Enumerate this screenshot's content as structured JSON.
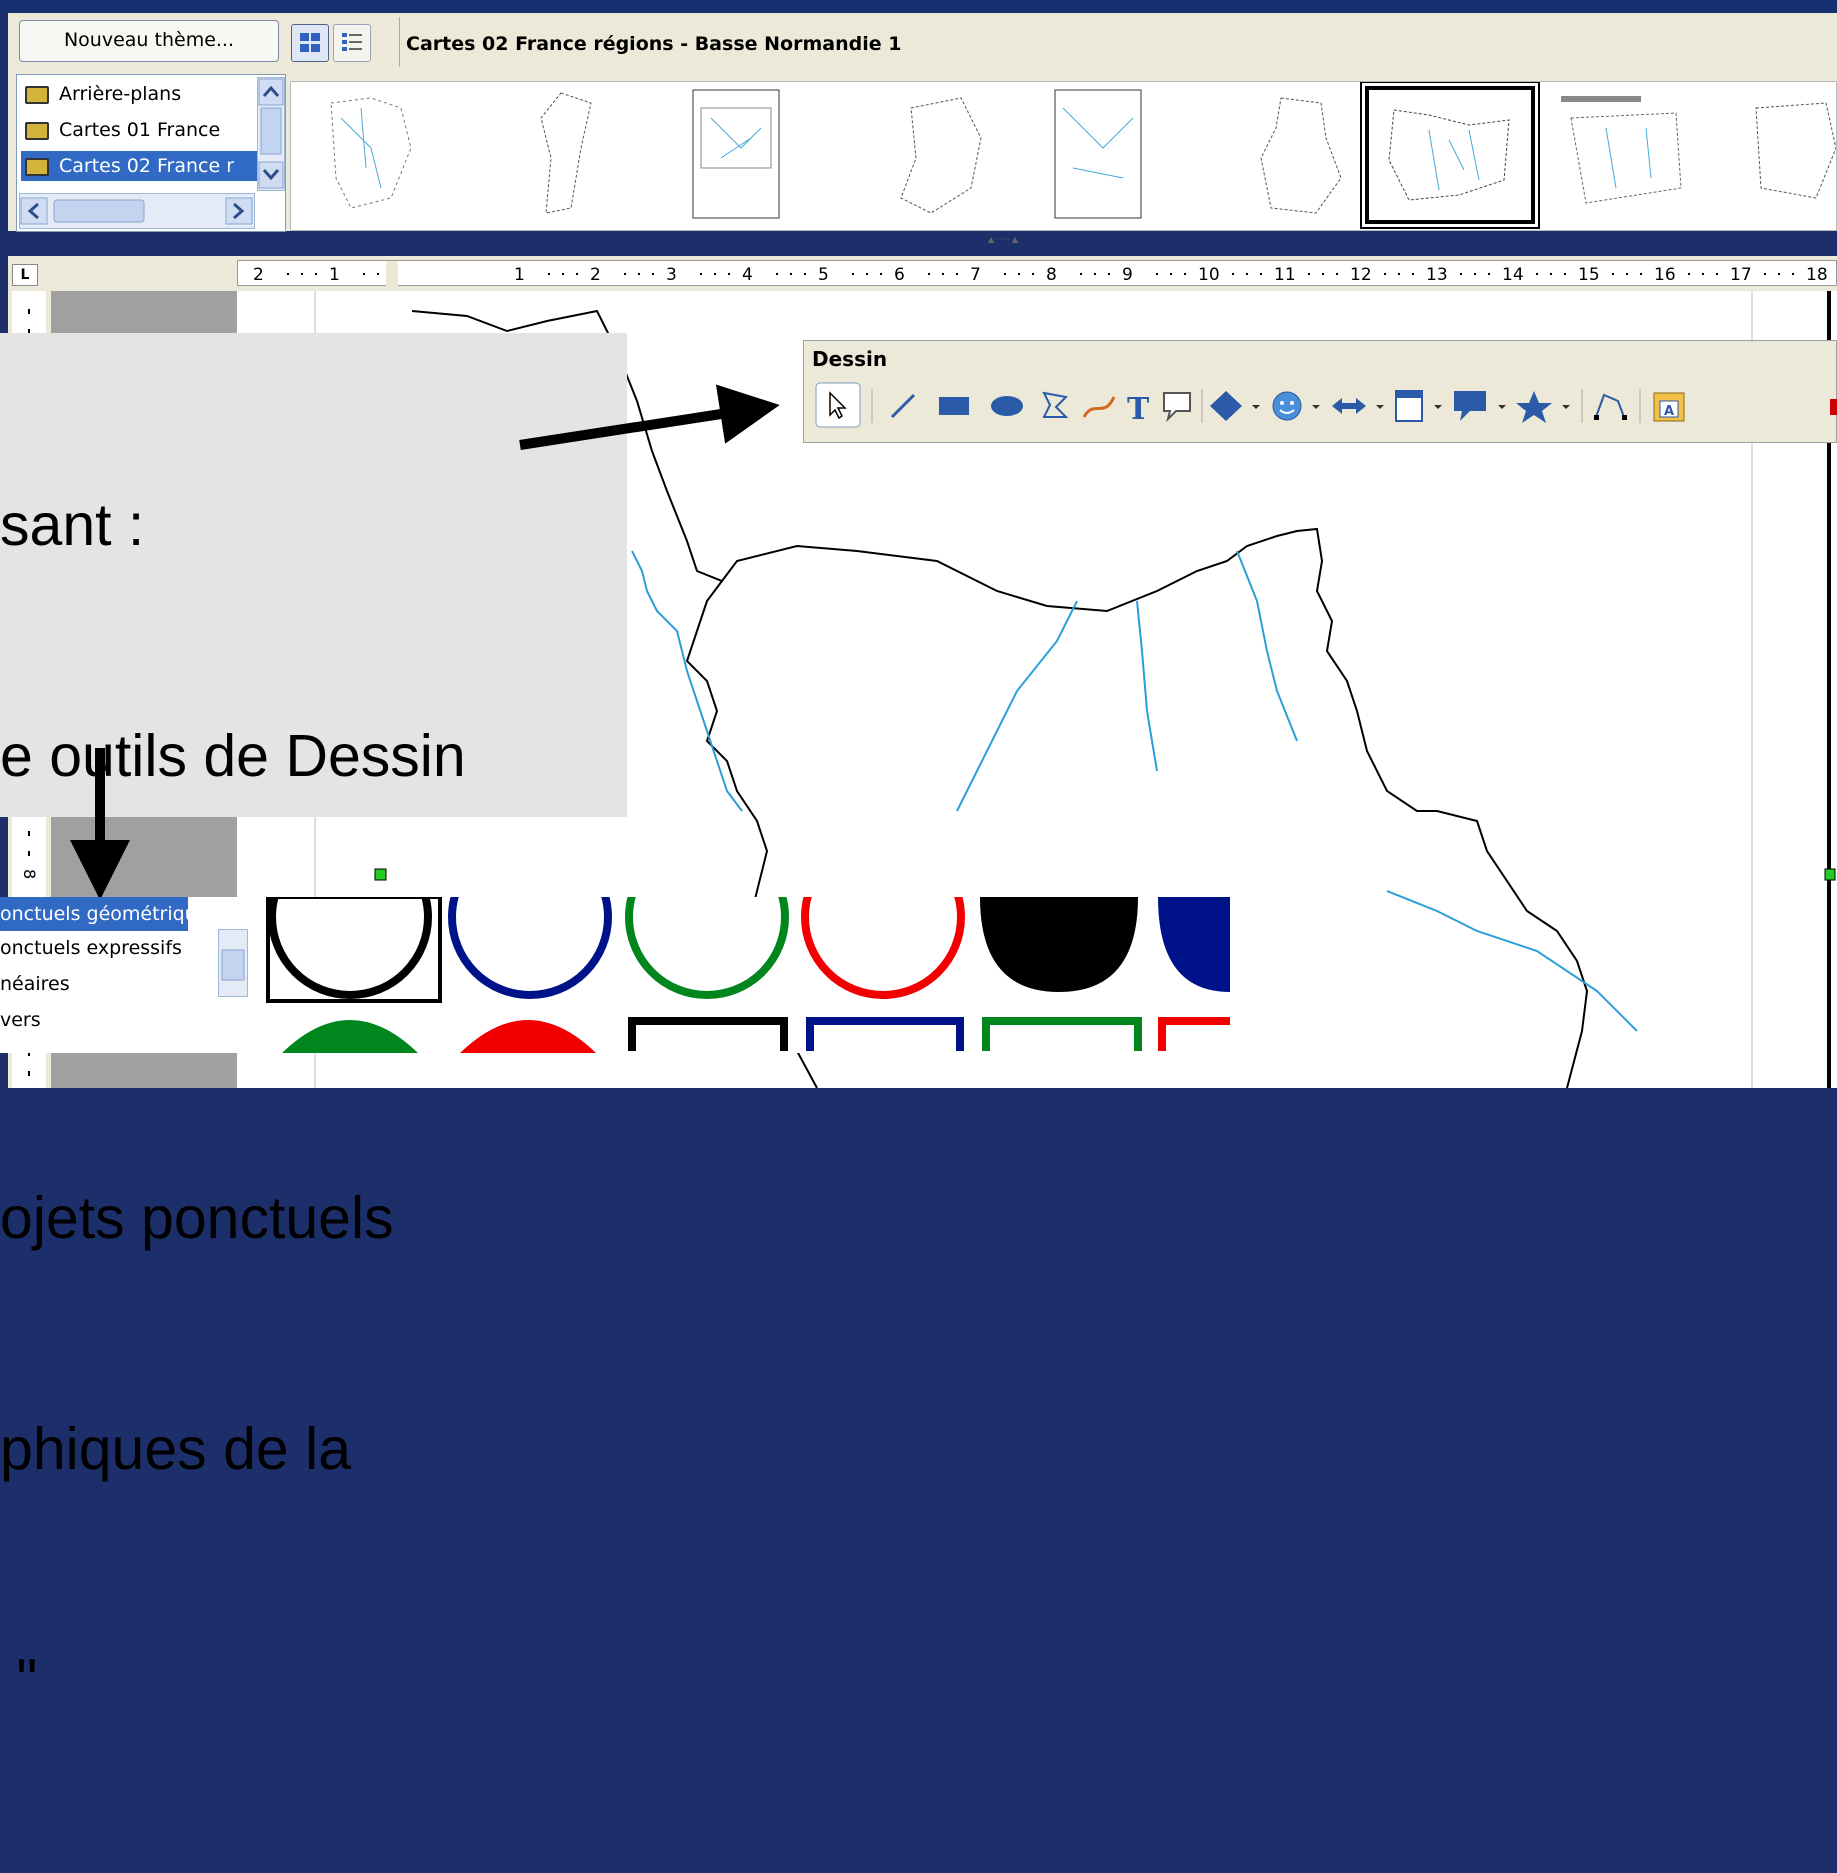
{
  "gallery": {
    "new_theme_button": "Nouveau thème...",
    "view_icons": [
      "icon-view-icon",
      "detail-view-icon"
    ],
    "title": "Cartes 02 France régions - Basse Normandie 1",
    "themes": [
      "Arrière-plans",
      "Cartes 01 France",
      "Cartes 02 France r"
    ],
    "selected_theme_index": 2,
    "splitter_icon": "splitter-grip-icon"
  },
  "ruler": {
    "corner_label": "L",
    "ticks": [
      "2",
      "1",
      "1",
      "2",
      "3",
      "4",
      "5",
      "6",
      "7",
      "8",
      "9",
      "10",
      "11",
      "12",
      "13",
      "14",
      "15",
      "16",
      "17",
      "18"
    ]
  },
  "vruler": {
    "labels": [
      "8"
    ]
  },
  "callout": {
    "lines": [
      "sant :",
      "e outils de Dessin",
      "",
      "ojets ponctuels",
      "phiques de la",
      " \""
    ]
  },
  "drawing_toolbar": {
    "title": "Dessin",
    "tools": [
      "select-icon",
      "line-icon",
      "rectangle-icon",
      "ellipse-icon",
      "polygon-icon",
      "freeform-icon",
      "text-icon",
      "callout-icon",
      "basic-shapes-icon",
      "symbol-shapes-icon",
      "block-arrows-icon",
      "flowchart-icon",
      "callouts-icon",
      "stars-icon",
      "points-icon",
      "fontwork-icon"
    ]
  },
  "bottom_list": {
    "items": [
      "onctuels géométriques",
      "onctuels expressifs",
      "néaires",
      "vers"
    ],
    "selected_index": 0
  },
  "colors": {
    "accent_blue": "#316ac5",
    "river_blue": "#2a9fd8",
    "window_bg": "#ece9d8",
    "slide_bg": "#1c2f6b"
  }
}
